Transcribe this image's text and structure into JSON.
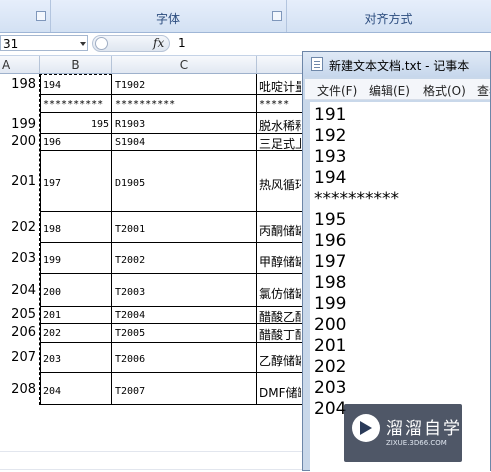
{
  "ribbon": {
    "font_group_label": "字体",
    "align_group_label": "对齐方式"
  },
  "formula_bar": {
    "name_box": "31",
    "fx_label": "fx",
    "value": "1"
  },
  "columns": [
    "A",
    "B",
    "C"
  ],
  "rows": [
    {
      "num": "198",
      "b": "194",
      "c": "T1902",
      "d": "吡啶计量"
    },
    {
      "num": "",
      "b": "**********",
      "c": "**********",
      "d": "*****"
    },
    {
      "num": "199",
      "b": "195",
      "c": "R1903",
      "d": "脱水稀释"
    },
    {
      "num": "200",
      "b": "196",
      "c": "S1904",
      "d": "三足式上"
    },
    {
      "num": "201",
      "b": "197",
      "c": "D1905",
      "d": "热风循环"
    },
    {
      "num": "202",
      "b": "198",
      "c": "T2001",
      "d": "丙酮储罐"
    },
    {
      "num": "203",
      "b": "199",
      "c": "T2002",
      "d": "甲醇储罐"
    },
    {
      "num": "204",
      "b": "200",
      "c": "T2003",
      "d": "氯仿储罐"
    },
    {
      "num": "205",
      "b": "201",
      "c": "T2004",
      "d": "醋酸乙酯"
    },
    {
      "num": "206",
      "b": "202",
      "c": "T2005",
      "d": "醋酸丁酯"
    },
    {
      "num": "207",
      "b": "203",
      "c": "T2006",
      "d": "乙醇储罐"
    },
    {
      "num": "208",
      "b": "204",
      "c": "T2007",
      "d": "DMF储罐"
    }
  ],
  "notepad": {
    "title": "新建文本文档.txt - 记事本",
    "menu": [
      "文件(F)",
      "编辑(E)",
      "格式(O)",
      "查看"
    ],
    "lines": [
      "191",
      "192",
      "193",
      "194",
      "**********",
      "195",
      "196",
      "197",
      "198",
      "199",
      "200",
      "201",
      "202",
      "203",
      "204"
    ]
  },
  "watermark": {
    "title": "溜溜自学",
    "subtitle": "ZIXUE.3D66.COM"
  }
}
